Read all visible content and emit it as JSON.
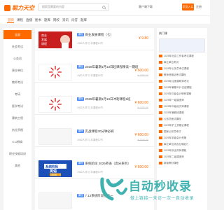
{
  "header": {
    "logo_text": "聪力天空",
    "search_placeholder": "搜索您需要的内容",
    "links": "客户端下载",
    "login_label": "学员入口",
    "extra": "注册"
  },
  "nav": {
    "items": [
      "首页",
      "课程",
      "直播",
      "图书",
      "题库",
      "网校",
      "资讯",
      "问答",
      "题库"
    ]
  },
  "sidebar": {
    "items": [
      "全部",
      "社会考试",
      "公务员",
      "事业单位",
      "教师考试",
      "考研",
      "医学考试",
      "建筑工程",
      "执业资格",
      "K12教育",
      "职业技能培训",
      "其他"
    ]
  },
  "courses": [
    {
      "tag": "课程",
      "title": "商业发展课程（七）",
      "meta": "1982人学习    本课程14节",
      "price": "¥ 9.80",
      "old_price": "",
      "thumb": "red",
      "thumb_text": "商业\n发展\n课程"
    },
    {
      "tag": "课程",
      "title": "2025年暑期1月13日起课程精读一期班",
      "meta": "1982人学习    本课程18节",
      "price": "¥ 600.00",
      "old_price": "¥ 1200.00",
      "thumb": "rays",
      "thumb_text": ""
    },
    {
      "tag": "课程",
      "title": "2025年暑期1月13日冲刺课程2班",
      "meta": "1982人学习    本课程16节",
      "price": "¥ 600.00",
      "old_price": "¥ 1200.00",
      "thumb": "rays",
      "thumb_text": ""
    },
    {
      "tag": "课程",
      "title": "实战课程30分钟必刷",
      "meta": "1982人学习    本课程12节",
      "price": "¥ 600.00",
      "old_price": "¥ 1200.00",
      "thumb": "blank",
      "thumb_text": ""
    },
    {
      "tag": "课程",
      "title": "系统阶段 2026英语（高分系列）",
      "meta": "1982人学习    本课程10节",
      "price": "¥ 600.00",
      "old_price": "",
      "thumb": "blue",
      "thumb_text": "系统阶段\n英语\n2026"
    },
    {
      "tag": "课程",
      "title": "7.12系统阶段强化一",
      "meta": "",
      "price": "",
      "old_price": "",
      "thumb": "blank",
      "thumb_text": ""
    }
  ],
  "right_panel": {
    "heading": "热门课",
    "items": [
      "2025年社会工作者考试课程",
      "事业单位考试",
      "2025年公务员考试课程",
      "教师资格证考试课程",
      "2025年注册建筑师考试",
      "2025年暑期3月1日起课程",
      "2025年中级会计职称课程",
      "2025年一级建造师",
      "2025年中级经济师课程",
      "2025年暑假班课程",
      "公务员面试课程",
      "2025年护士资格证课程",
      "国家公务员考试",
      "2025年初级会计资格",
      "事业单位综合应用能力",
      "2025年执业药师课程",
      "2025年二级建造师",
      "新版教材课程"
    ]
  },
  "watermark": {
    "title": "自动秒收录",
    "sub": "做上链接一未访一次一自动收录"
  }
}
